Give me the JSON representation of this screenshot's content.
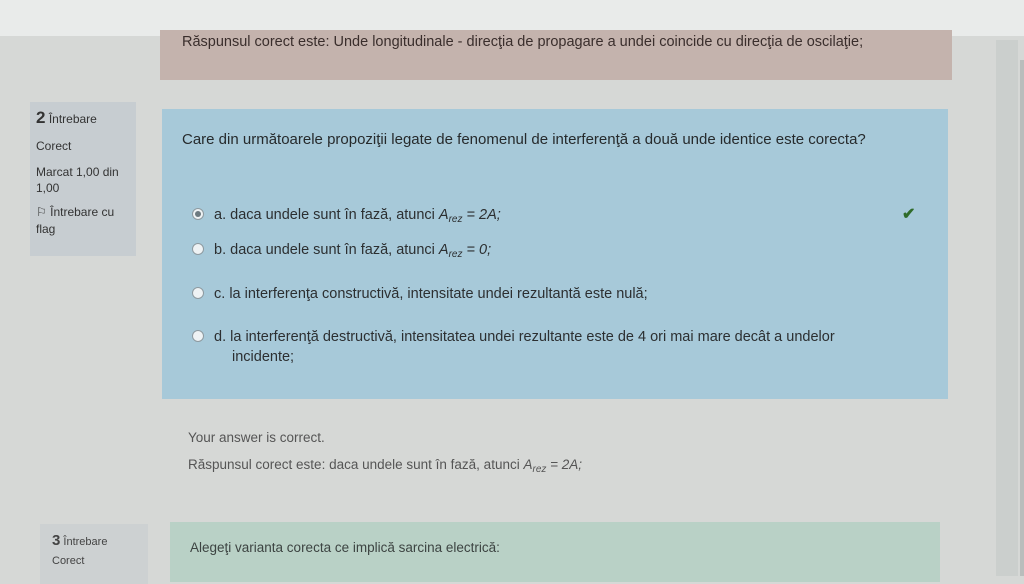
{
  "previous_feedback": {
    "text": "Răspunsul corect este: Unde longitudinale - direcţia de propagare a undei coincide cu direcţia de oscilaţie;"
  },
  "question2": {
    "info": {
      "number": "2",
      "label": "Întrebare",
      "status": "Corect",
      "mark": "Marcat 1,00 din 1,00",
      "flag_label": "Întrebare cu flag"
    },
    "text": "Care din următoarele propoziţii legate de fenomenul de interferenţă a două unde identice este corecta?",
    "answers": [
      {
        "prefix": "a.",
        "text": "daca undele sunt în fază, atunci",
        "math": "A",
        "sub": "rez",
        "tail": " = 2A;",
        "selected": true
      },
      {
        "prefix": "b.",
        "text": "daca undele sunt în fază, atunci",
        "math": "A",
        "sub": "rez",
        "tail": " = 0;",
        "selected": false
      },
      {
        "prefix": "c.",
        "text": "la interferenţa constructivă, intensitate undei rezultantă este nulă;",
        "selected": false
      },
      {
        "prefix": "d.",
        "text": "la interferenţă destructivă, intensitatea undei rezultante este de 4 ori mai mare decât a undelor",
        "text2": "incidente;",
        "selected": false
      }
    ],
    "correct_icon": "checkmark-icon",
    "feedback": {
      "result": "Your answer is correct.",
      "correct_prefix": "Răspunsul corect este: daca undele sunt în fază, atunci",
      "correct_math": "A",
      "correct_sub": "rez",
      "correct_tail": " = 2A;"
    }
  },
  "question3": {
    "info": {
      "number": "3",
      "label": "Întrebare",
      "status": "Corect"
    },
    "text": "Alegeţi varianta corecta ce implică sarcina electrică:"
  },
  "colors": {
    "question_bg": "#a7c9d9",
    "feedback_bg": "#c4b3ad",
    "correct_green": "#2f6b2a"
  }
}
